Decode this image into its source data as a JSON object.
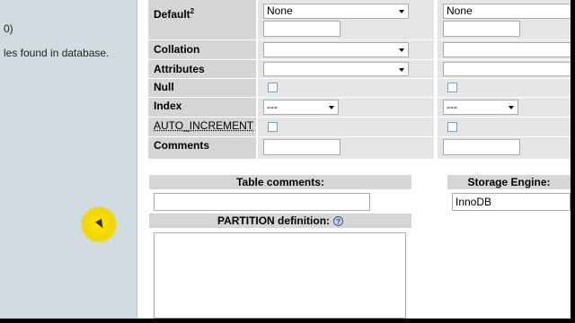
{
  "sidebar": {
    "line1": "0)",
    "line2": "les found in database."
  },
  "fields": {
    "default_label": "Default",
    "default_sup": "2",
    "default_select_1": "None",
    "default_select_2": "None",
    "collation_label": "Collation",
    "attributes_label": "Attributes",
    "null_label": "Null",
    "index_label": "Index",
    "index_select_1": "---",
    "index_select_2": "---",
    "auto_increment_label": "AUTO_INCREMENT",
    "comments_label": "Comments"
  },
  "table_comments": {
    "label": "Table comments:"
  },
  "storage_engine": {
    "label": "Storage Engine:",
    "value": "InnoDB"
  },
  "partition": {
    "label": "PARTITION definition:",
    "help": "?"
  },
  "colors": {
    "sidebar": "#d0dce0",
    "label_bg": "#d5d5d5",
    "cell_bg": "#e5e5e5",
    "cursor": "#f2d600"
  }
}
